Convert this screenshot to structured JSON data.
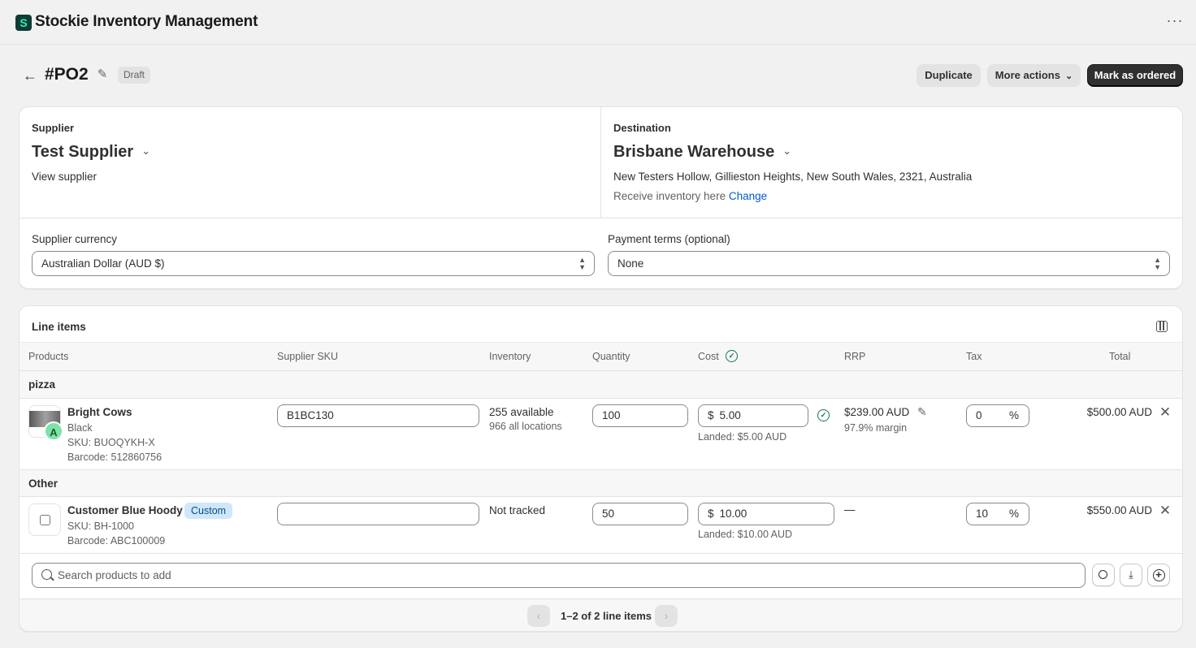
{
  "app": {
    "title": "Stockie Inventory Management",
    "menu": "···"
  },
  "header": {
    "title": "#PO2",
    "status": "Draft",
    "duplicate_label": "Duplicate",
    "more_actions_label": "More actions",
    "mark_ordered_label": "Mark as ordered"
  },
  "supplier": {
    "label": "Supplier",
    "name": "Test Supplier",
    "view_link": "View supplier"
  },
  "destination": {
    "label": "Destination",
    "name": "Brisbane Warehouse",
    "address": "New Testers Hollow, Gillieston Heights, New South Wales, 2321, Australia",
    "receive_text": "Receive inventory here",
    "change_link": "Change"
  },
  "currency": {
    "label": "Supplier currency",
    "value": "Australian Dollar (AUD $)"
  },
  "payment_terms": {
    "label": "Payment terms (optional)",
    "value": "None"
  },
  "line_items": {
    "title": "Line items",
    "columns": [
      "Products",
      "Supplier SKU",
      "Inventory",
      "Quantity",
      "Cost",
      "RRP",
      "Tax",
      "Total"
    ],
    "groups": [
      {
        "name": "pizza",
        "item": {
          "name": "Bright Cows",
          "variant": "Black",
          "sku": "SKU: BUOQYKH-X",
          "barcode": "Barcode: 512860756",
          "avatar_letter": "A",
          "supplier_sku": "B1BC130",
          "inventory": "255 available",
          "inventory_sub": "966 all locations",
          "quantity": "100",
          "currency_symbol": "$",
          "cost": "5.00",
          "landed": "Landed: $5.00 AUD",
          "rrp": "$239.00 AUD",
          "margin": "97.9% margin",
          "tax": "0",
          "tax_unit": "%",
          "total": "$500.00 AUD"
        }
      },
      {
        "name": "Other",
        "item": {
          "name": "Customer Blue Hoody",
          "badge": "Custom",
          "sku": "SKU: BH-1000",
          "barcode": "Barcode: ABC100009",
          "supplier_sku": "",
          "inventory": "Not tracked",
          "quantity": "50",
          "currency_symbol": "$",
          "cost": "10.00",
          "landed": "Landed: $10.00 AUD",
          "rrp": "—",
          "tax": "10",
          "tax_unit": "%",
          "total": "$550.00 AUD"
        }
      }
    ],
    "search_placeholder": "Search products to add",
    "pagination": "1–2 of 2 line items"
  }
}
